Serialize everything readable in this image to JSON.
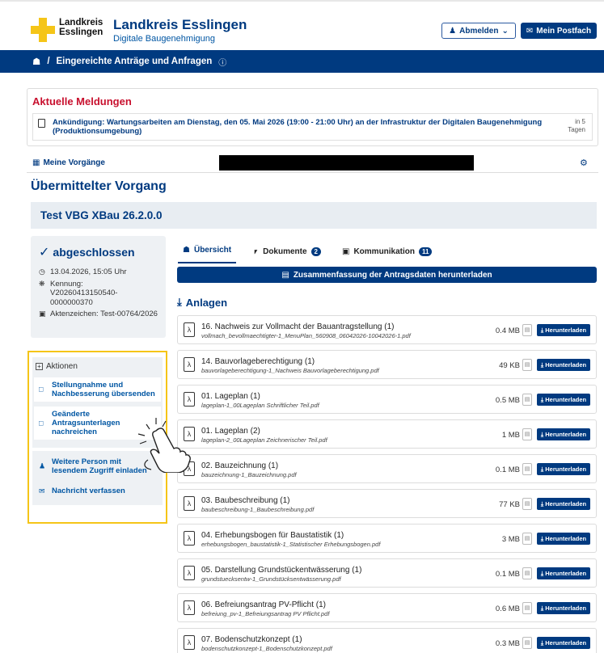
{
  "header": {
    "logo_text": [
      "Landkreis",
      "Esslingen"
    ],
    "title": "Landkreis Esslingen",
    "subtitle": "Digitale Baugenehmigung",
    "logout_label": "Abmelden",
    "mailbox_label": "Mein Postfach"
  },
  "breadcrumb": {
    "current": "Eingereichte Anträge und Anfragen"
  },
  "news": {
    "title": "Aktuelle Meldungen",
    "item": "Ankündigung: Wartungsarbeiten am Dienstag, den 05. Mai 2026 (19:00 - 21:00 Uhr) an der Infrastruktur der Digitalen Baugenehmigung (Produktionsumgebung)",
    "when_top": "in 5",
    "when_bottom": "Tagen"
  },
  "vorgaenge_label": "Meine Vorgänge",
  "page_title": "Übermittelter Vorgang",
  "vbg_title": "Test VBG XBau 26.2.0.0",
  "status": {
    "label": "abgeschlossen",
    "datetime": "13.04.2026, 15:05 Uhr",
    "kennung_label": "Kennung:",
    "kennung_value": "V20260413150540-0000000370",
    "aktenzeichen": "Aktenzeichen: Test-00764/2026"
  },
  "aktionen": {
    "title": "Aktionen",
    "items": [
      "Stellungnahme und Nachbesserung übersenden",
      "Geänderte Antragsunterlagen nachreichen",
      "Weitere Person mit lesendem Zugriff einladen",
      "Nachricht verfassen"
    ]
  },
  "tabs": [
    {
      "label": "Übersicht",
      "badge": ""
    },
    {
      "label": "Dokumente",
      "badge": "2"
    },
    {
      "label": "Kommunikation",
      "badge": "11"
    }
  ],
  "summary_button": "Zusammenfassung der Antragsdaten herunterladen",
  "anlagen_title": "Anlagen",
  "download_label": "Herunterladen",
  "files": [
    {
      "title": "16. Nachweis zur Vollmacht der Bauantragstellung (1)",
      "name": "vollmach_bevollmaechtigter-1_MenuPlan_560908_06042026-10042026-1.pdf",
      "size": "0.4 MB"
    },
    {
      "title": "14. Bauvorlageberechtigung (1)",
      "name": "bauvorlageberechtigung-1_Nachweis Bauvorlageberechtigung.pdf",
      "size": "49 KB"
    },
    {
      "title": "01. Lageplan (1)",
      "name": "lageplan-1_00Lageplan Schriftlicher Teil.pdf",
      "size": "0.5 MB"
    },
    {
      "title": "01. Lageplan (2)",
      "name": "lageplan-2_00Lageplan Zeichnerischer Teil.pdf",
      "size": "1 MB"
    },
    {
      "title": "02. Bauzeichnung (1)",
      "name": "bauzeichnung-1_Bauzeichnung.pdf",
      "size": "0.1 MB"
    },
    {
      "title": "03. Baubeschreibung (1)",
      "name": "baubeschreibung-1_Baubeschreibung.pdf",
      "size": "77 KB"
    },
    {
      "title": "04. Erhebungsbogen für Baustatistik (1)",
      "name": "erhebungsbogen_baustatistik-1_Statistischer Erhebungsbogen.pdf",
      "size": "3 MB"
    },
    {
      "title": "05. Darstellung Grundstückentwässerung (1)",
      "name": "grundstuecksentw-1_Grundstücksentwässerung.pdf",
      "size": "0.1 MB"
    },
    {
      "title": "06. Befreiungsantrag PV-Pflicht (1)",
      "name": "befreiung_pv-1_Befreiungsantrag PV Pflicht.pdf",
      "size": "0.6 MB"
    },
    {
      "title": "07. Bodenschutzkonzept (1)",
      "name": "bodenschutzkonzept-1_Bodenschutzkonzept.pdf",
      "size": "0.3 MB"
    }
  ]
}
